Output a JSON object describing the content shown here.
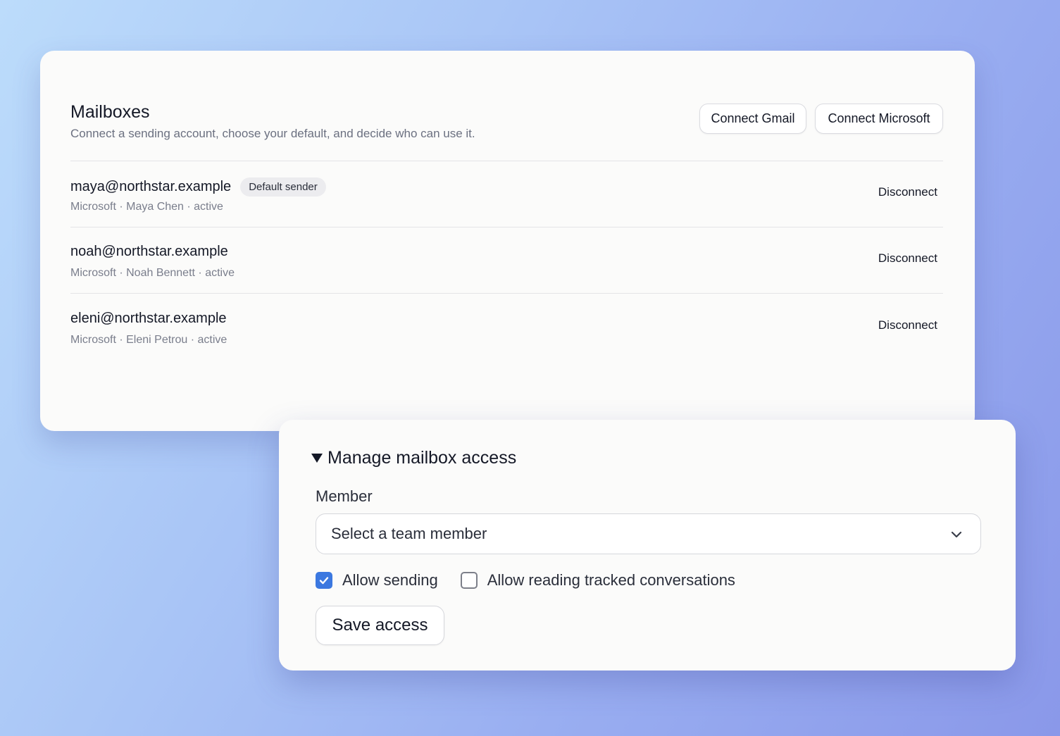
{
  "colors": {
    "accent": "#3b78e0",
    "text_primary": "#141826",
    "text_secondary": "#6b7080",
    "card_bg": "#fbfbfa"
  },
  "mailboxes": {
    "title": "Mailboxes",
    "subtitle": "Connect a sending account, choose your default, and decide who can use it.",
    "connect_gmail_label": "Connect Gmail",
    "connect_microsoft_label": "Connect Microsoft",
    "items": [
      {
        "email": "maya@northstar.example",
        "badge": "Default sender",
        "meta": "Microsoft · Maya Chen · active",
        "action": "Disconnect"
      },
      {
        "email": "noah@northstar.example",
        "meta": "Microsoft · Noah Bennett · active",
        "action": "Disconnect"
      },
      {
        "email": "eleni@northstar.example",
        "meta": "Microsoft · Eleni Petrou · active",
        "action": "Disconnect"
      }
    ]
  },
  "access": {
    "summary": "Manage mailbox access",
    "member_label": "Member",
    "member_select_value": "Select a team member",
    "allow_sending_label": "Allow sending",
    "allow_sending_checked": true,
    "allow_reading_label": "Allow reading tracked conversations",
    "allow_reading_checked": false,
    "save_label": "Save access"
  },
  "icons": {
    "summary_toggle": "triangle-down-icon",
    "select_chevron": "chevron-down-icon",
    "checkmark": "check-icon"
  }
}
